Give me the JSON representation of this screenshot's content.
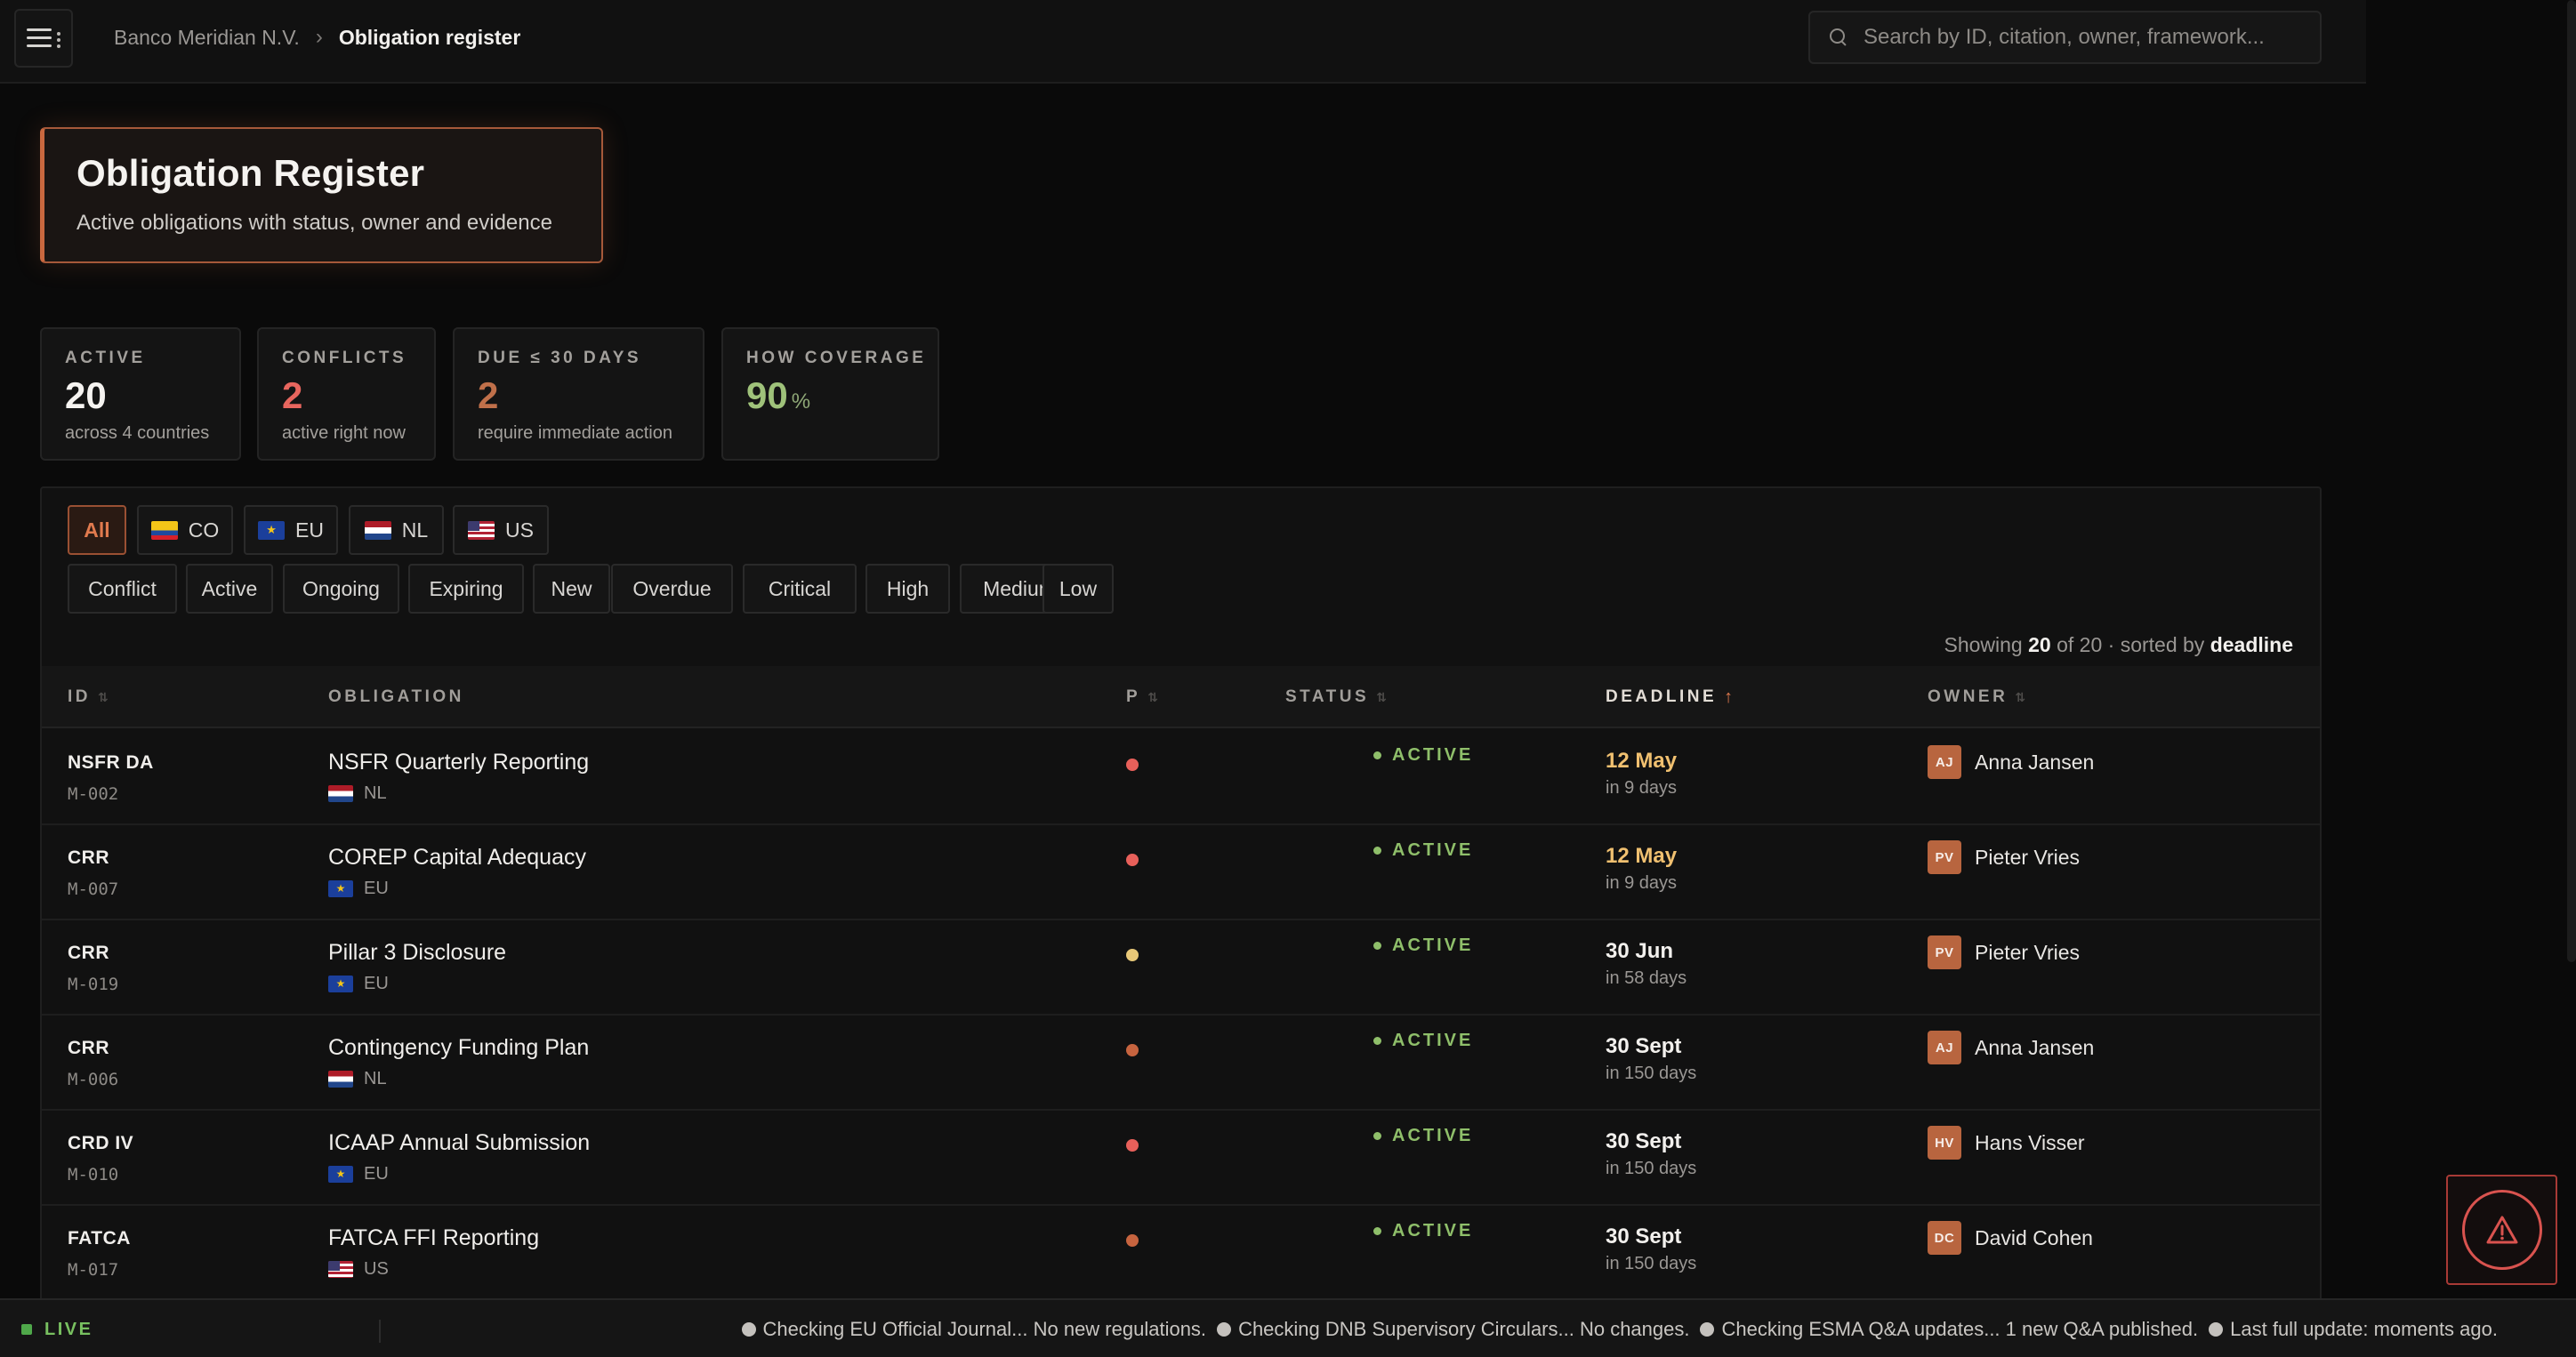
{
  "breadcrumb": {
    "org": "Banco Meridian N.V.",
    "separator": "›",
    "current": "Obligation register"
  },
  "search": {
    "placeholder": "Search by ID, citation, owner, framework..."
  },
  "header": {
    "title": "Obligation Register",
    "subtitle": "Active obligations with status, owner and evidence"
  },
  "stats": {
    "active": {
      "label": "ACTIVE",
      "value": "20",
      "sub": "across 4 countries"
    },
    "conflicts": {
      "label": "CONFLICTS",
      "value": "2",
      "sub": "active right now"
    },
    "due": {
      "label": "DUE ≤ 30 DAYS",
      "value": "2",
      "sub": "require immediate action"
    },
    "coverage": {
      "label": "HOW COVERAGE",
      "value": "90",
      "unit": "%"
    }
  },
  "filters": {
    "countries": [
      "All",
      "CO",
      "EU",
      "NL",
      "US"
    ],
    "statuses": [
      "Conflict",
      "Active",
      "Ongoing",
      "Expiring",
      "New",
      "Overdue",
      "Critical",
      "High",
      "Medium",
      "Low"
    ]
  },
  "summary": {
    "prefix": "Showing",
    "count": "20",
    "middle": "of 20 · sorted by",
    "sort": "deadline"
  },
  "table": {
    "headers": {
      "id": "ID",
      "obligation": "OBLIGATION",
      "priority": "P",
      "status": "STATUS",
      "deadline": "DEADLINE",
      "owner": "OWNER"
    },
    "rows": [
      {
        "id": "NSFR DA",
        "code": "M-002",
        "title": "NSFR Quarterly Reporting",
        "country": "NL",
        "priority": "critical",
        "status": "ACTIVE",
        "deadline": "12 May",
        "relative": "in 9 days",
        "initials": "AJ",
        "owner": "Anna Jansen",
        "urgent": true
      },
      {
        "id": "CRR",
        "code": "M-007",
        "title": "COREP Capital Adequacy",
        "country": "EU",
        "priority": "critical",
        "status": "ACTIVE",
        "deadline": "12 May",
        "relative": "in 9 days",
        "initials": "PV",
        "owner": "Pieter Vries",
        "urgent": true
      },
      {
        "id": "CRR",
        "code": "M-019",
        "title": "Pillar 3 Disclosure",
        "country": "EU",
        "priority": "medium",
        "status": "ACTIVE",
        "deadline": "30 Jun",
        "relative": "in 58 days",
        "initials": "PV",
        "owner": "Pieter Vries",
        "urgent": false
      },
      {
        "id": "CRR",
        "code": "M-006",
        "title": "Contingency Funding Plan",
        "country": "NL",
        "priority": "high",
        "status": "ACTIVE",
        "deadline": "30 Sept",
        "relative": "in 150 days",
        "initials": "AJ",
        "owner": "Anna Jansen",
        "urgent": false
      },
      {
        "id": "CRD IV",
        "code": "M-010",
        "title": "ICAAP Annual Submission",
        "country": "EU",
        "priority": "critical",
        "status": "ACTIVE",
        "deadline": "30 Sept",
        "relative": "in 150 days",
        "initials": "HV",
        "owner": "Hans Visser",
        "urgent": false
      },
      {
        "id": "FATCA",
        "code": "M-017",
        "title": "FATCA FFI Reporting",
        "country": "US",
        "priority": "high",
        "status": "ACTIVE",
        "deadline": "30 Sept",
        "relative": "in 150 days",
        "initials": "DC",
        "owner": "David Cohen",
        "urgent": false
      }
    ]
  },
  "statusbar": {
    "live": "LIVE",
    "ticker": [
      "Checking EU Official Journal... No new regulations.",
      "Checking DNB Supervisory Circulars... No changes.",
      "Checking ESMA Q&A updates... 1 new Q&A published.",
      "Last full update: moments ago."
    ]
  },
  "colors": {
    "accent": "#c9683f",
    "active_green": "#8fbf6a",
    "conflict_red": "#e8665e",
    "due_orange": "#c0704a",
    "coverage_green": "#9fc27a",
    "deadline_urgent": "#f0c070",
    "priority_critical": "#e8605a",
    "priority_high": "#c7643f",
    "priority_medium": "#e8c878"
  },
  "icons": {
    "menu": "hamburger-icon",
    "search": "search-icon",
    "alert": "warning-triangle-icon"
  }
}
